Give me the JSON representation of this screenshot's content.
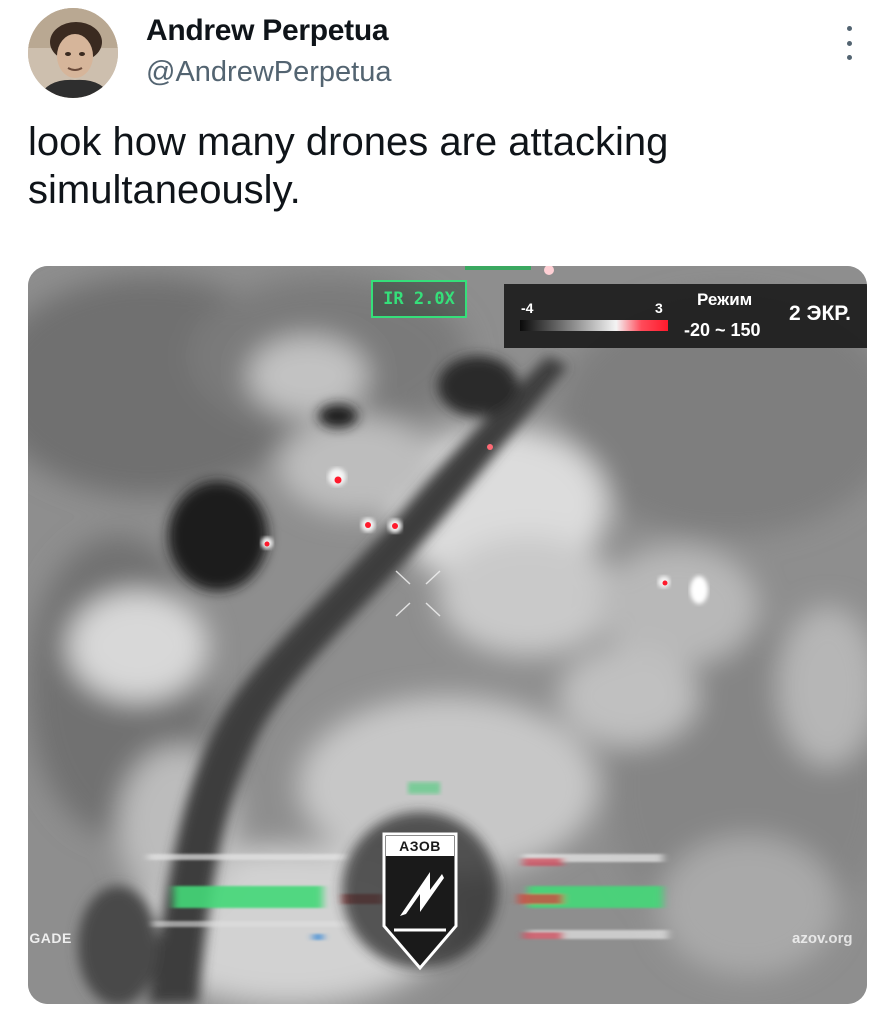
{
  "tweet": {
    "author_name": "Andrew Perpetua",
    "author_handle": "@AndrewPerpetua",
    "text": "look how many drones are attacking simultaneously.",
    "more_icon": "more-vertical-icon"
  },
  "media": {
    "ir_zoom": "IR 2.0X",
    "scale_min": "-4",
    "scale_max": "3",
    "mode_label": "Режим",
    "mode_range": "-20 ~ 150",
    "screen_label": "2 ЭКР.",
    "watermark_left": "IGADE",
    "watermark_right": "azov.org",
    "logo_text": "АЗОВ"
  },
  "colors": {
    "hud_green": "#35e07a",
    "hotspot_red": "#ff1a2c",
    "handle_gray": "#536471"
  }
}
